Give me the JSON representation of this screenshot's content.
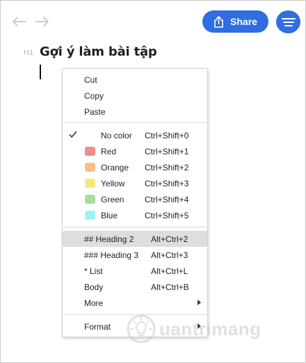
{
  "toolbar": {
    "back_icon": "arrow-left-icon",
    "forward_icon": "arrow-right-icon",
    "share_label": "Share",
    "share_icon": "share-icon",
    "menu_icon": "hamburger-menu-icon",
    "accent": "#2f6de1"
  },
  "document": {
    "heading_marker": "H1",
    "title": "Gợi ý làm bài tập"
  },
  "context_menu": {
    "clipboard": [
      {
        "label": "Cut"
      },
      {
        "label": "Copy"
      },
      {
        "label": "Paste"
      }
    ],
    "colors": [
      {
        "label": "No color",
        "shortcut": "Ctrl+Shift+0",
        "checked": true,
        "swatch": null
      },
      {
        "label": "Red",
        "shortcut": "Ctrl+Shift+1",
        "swatch": "#f28b8b"
      },
      {
        "label": "Orange",
        "shortcut": "Ctrl+Shift+2",
        "swatch": "#f7be8a"
      },
      {
        "label": "Yellow",
        "shortcut": "Ctrl+Shift+3",
        "swatch": "#f5e77a"
      },
      {
        "label": "Green",
        "shortcut": "Ctrl+Shift+4",
        "swatch": "#a8dc9b"
      },
      {
        "label": "Blue",
        "shortcut": "Ctrl+Shift+5",
        "swatch": "#9cf3f6"
      }
    ],
    "blocks": [
      {
        "label": "## Heading 2",
        "shortcut": "Alt+Ctrl+2",
        "highlighted": true
      },
      {
        "label": "### Heading 3",
        "shortcut": "Alt+Ctrl+3"
      },
      {
        "label": "* List",
        "shortcut": "Alt+Ctrl+L"
      },
      {
        "label": "Body",
        "shortcut": "Alt+Ctrl+B"
      },
      {
        "label": "More",
        "submenu": true
      }
    ],
    "format": {
      "label": "Format",
      "submenu": true
    }
  },
  "watermark": {
    "text": "uantrimang",
    "icon": "lightbulb-logo-icon"
  }
}
